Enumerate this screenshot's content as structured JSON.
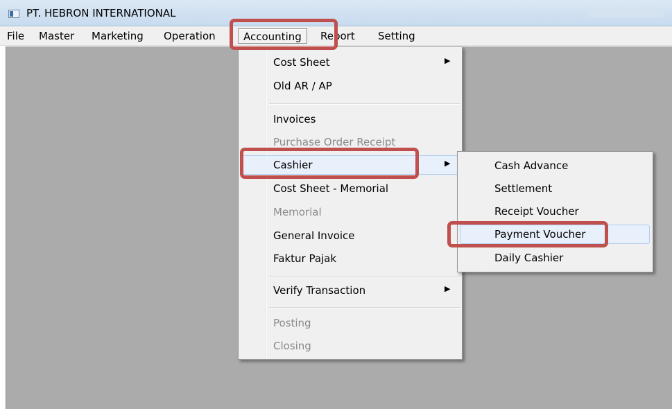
{
  "window": {
    "title": "PT. HEBRON INTERNATIONAL"
  },
  "menubar": {
    "items": [
      "File",
      "Master",
      "Marketing",
      "Operation",
      "Accounting",
      "Report",
      "Setting"
    ]
  },
  "accounting_menu": {
    "items": [
      {
        "label": "Cost Sheet",
        "submenu": true
      },
      {
        "label": "Old AR / AP"
      },
      {
        "label": "Invoices"
      },
      {
        "label": "Purchase Order Receipt",
        "disabled": true
      },
      {
        "label": "Cashier",
        "submenu": true
      },
      {
        "label": "Cost Sheet - Memorial"
      },
      {
        "label": "Memorial",
        "disabled": true
      },
      {
        "label": "General Invoice"
      },
      {
        "label": "Faktur Pajak"
      },
      {
        "label": "Verify Transaction",
        "submenu": true
      },
      {
        "label": "Posting",
        "disabled": true
      },
      {
        "label": "Closing",
        "disabled": true
      }
    ],
    "submenu_arrow": "▶"
  },
  "cashier_submenu": {
    "items": [
      "Cash Advance",
      "Settlement",
      "Receipt Voucher",
      "Payment Voucher",
      "Daily Cashier"
    ]
  },
  "highlight_color": "#c0504d"
}
